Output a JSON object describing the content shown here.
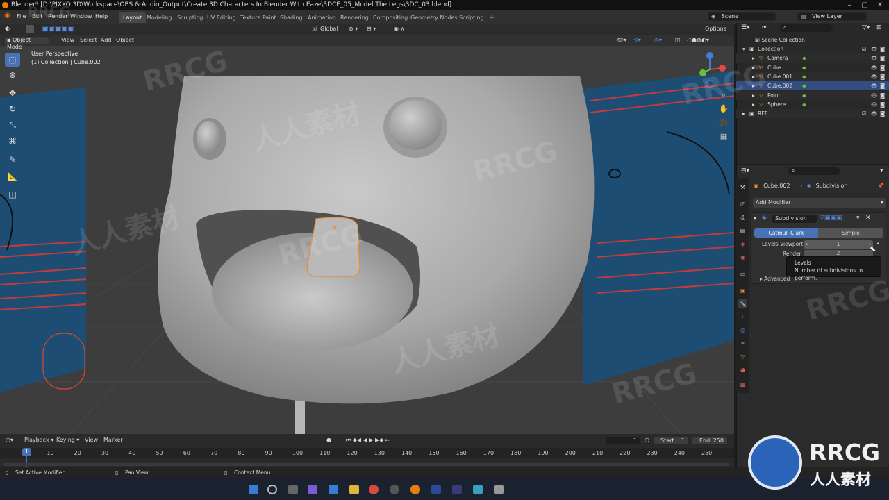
{
  "window": {
    "title": "Blender* [D:\\PIXXO 3D\\Workspace\\OBS & Audio_Output\\Create 3D Characters In Blender With Eaze\\3DCE_05_Model The Legs\\3DC_03.blend]"
  },
  "menu": {
    "items": [
      "File",
      "Edit",
      "Render",
      "Window",
      "Help"
    ]
  },
  "workspaces": [
    "Layout",
    "Modeling",
    "Sculpting",
    "UV Editing",
    "Texture Paint",
    "Shading",
    "Animation",
    "Rendering",
    "Compositing",
    "Geometry Nodes",
    "Scripting"
  ],
  "active_workspace": "Layout",
  "scene": {
    "name": "Scene",
    "view_layer": "View Layer"
  },
  "viewport": {
    "mode": "Object Mode",
    "menus": [
      "View",
      "Select",
      "Add",
      "Object"
    ],
    "transform_orientation": "Global",
    "options_label": "Options",
    "overlay_line1": "User Perspective",
    "overlay_line2": "(1) Collection | Cube.002"
  },
  "outliner": {
    "root": "Scene Collection",
    "rows": [
      {
        "label": "Collection",
        "kind": "collection",
        "selected": false
      },
      {
        "label": "Camera",
        "kind": "object",
        "selected": false
      },
      {
        "label": "Cube",
        "kind": "object",
        "selected": false
      },
      {
        "label": "Cube.001",
        "kind": "object",
        "selected": false
      },
      {
        "label": "Cube.002",
        "kind": "object",
        "selected": true
      },
      {
        "label": "Point",
        "kind": "object",
        "selected": false
      },
      {
        "label": "Sphere",
        "kind": "object",
        "selected": false
      },
      {
        "label": "REF",
        "kind": "collection",
        "selected": false
      }
    ]
  },
  "properties": {
    "object": "Cube.002",
    "modifier_context": "Subdivision",
    "add_modifier": "Add Modifier",
    "modifier": {
      "name": "Subdivision",
      "type_options": [
        "Catmull-Clark",
        "Simple"
      ],
      "active_type": "Catmull-Clark",
      "levels_viewport_label": "Levels Viewport",
      "levels_viewport_value": "1",
      "render_label": "Render",
      "render_value": "2",
      "advanced_label": "Advanced"
    },
    "tooltip": {
      "title": "Levels",
      "description": "Number of subdivisions to perform."
    }
  },
  "timeline": {
    "menus": [
      "Playback",
      "Keying",
      "View",
      "Marker"
    ],
    "current_frame": "1",
    "start_label": "Start",
    "start_value": "1",
    "end_label": "End",
    "end_value": "250",
    "ticks": [
      "1",
      "10",
      "20",
      "30",
      "40",
      "50",
      "60",
      "70",
      "80",
      "90",
      "100",
      "110",
      "120",
      "130",
      "140",
      "150",
      "160",
      "170",
      "180",
      "190",
      "200",
      "210",
      "220",
      "230",
      "240",
      "250"
    ]
  },
  "statusbar": {
    "left": "Set Active Modifier",
    "middle": "Pan View",
    "right": "Context Menu"
  },
  "watermark": {
    "brand": "RRCG",
    "cn": "人人素材"
  },
  "colors": {
    "accent": "#4772b3",
    "selection": "#334d80",
    "header": "#303030",
    "panel": "#2b2b2b",
    "viewport_bg": "#3d3d3d",
    "ref_plane": "#1e4d73",
    "ref_lines": "#c83a3a"
  }
}
